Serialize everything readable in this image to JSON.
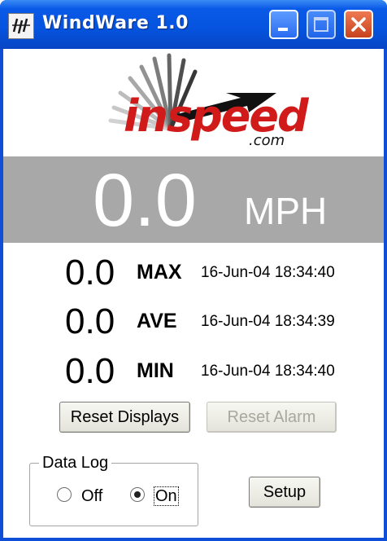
{
  "window": {
    "title": "WindWare 1.0",
    "icon": "windware-app-icon",
    "controls": {
      "minimize": "minimize-icon",
      "maximize": "maximize-icon",
      "close": "close-icon"
    }
  },
  "logo": {
    "brand": "inspeed",
    "domain": ".com",
    "brand_color": "#d11a1a"
  },
  "speed": {
    "value": "0.0",
    "unit": "MPH",
    "panel_color": "#a8a8a8"
  },
  "stats": [
    {
      "value": "0.0",
      "label": "MAX",
      "timestamp": "16-Jun-04 18:34:40"
    },
    {
      "value": "0.0",
      "label": "AVE",
      "timestamp": "16-Jun-04 18:34:39"
    },
    {
      "value": "0.0",
      "label": "MIN",
      "timestamp": "16-Jun-04 18:34:40"
    }
  ],
  "buttons": {
    "reset_displays": "Reset Displays",
    "reset_alarm": "Reset Alarm",
    "setup": "Setup"
  },
  "data_log": {
    "legend": "Data Log",
    "options": [
      {
        "label": "Off",
        "selected": false
      },
      {
        "label": "On",
        "selected": true
      }
    ]
  },
  "colors": {
    "titlebar": "#0553de",
    "close_button": "#d6502a"
  }
}
